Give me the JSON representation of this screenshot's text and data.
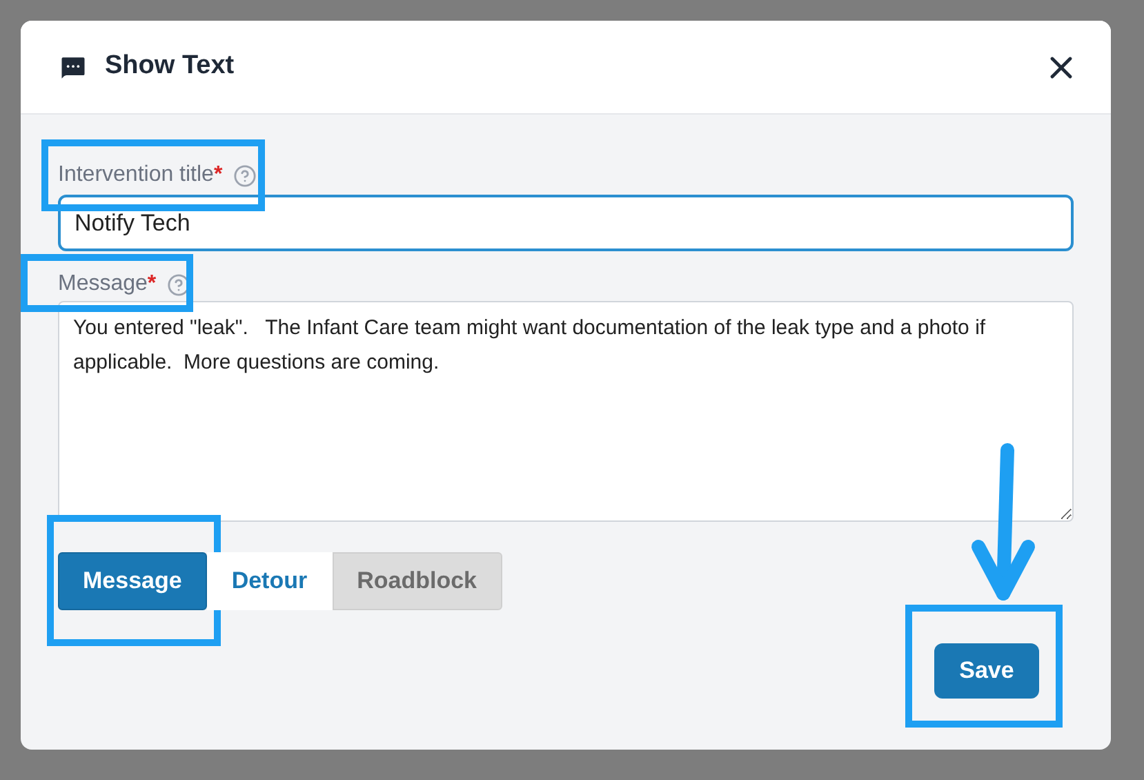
{
  "dialog": {
    "title": "Show Text"
  },
  "fields": [
    {
      "kind": "input",
      "label": "Intervention title",
      "required": true,
      "required_mark": "*",
      "highlighted": true,
      "value": "Notify Tech",
      "focused": true
    },
    {
      "kind": "textarea",
      "label": "Message",
      "required": true,
      "required_mark": "*",
      "highlighted": true,
      "value": "You entered \"leak\".   The Infant Care team might want documentation of the leak type and a photo if applicable.  More questions are coming.",
      "focused": false
    }
  ],
  "types": [
    {
      "label": "Message",
      "selected": true,
      "disabled": false,
      "highlighted": true
    },
    {
      "label": "Detour",
      "selected": false,
      "disabled": false,
      "highlighted": false
    },
    {
      "label": "Roadblock",
      "selected": false,
      "disabled": true,
      "highlighted": false
    }
  ],
  "save": {
    "label": "Save",
    "highlighted": true,
    "arrow": true
  }
}
